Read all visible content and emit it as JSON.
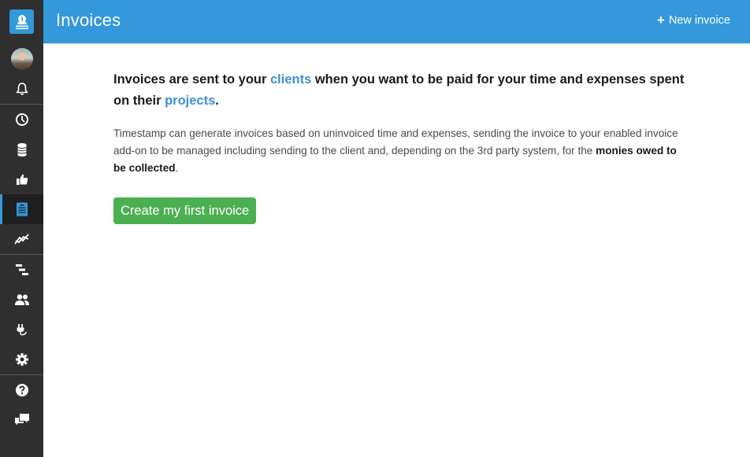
{
  "app": {
    "brand_color": "#3498db",
    "sidebar_bg": "#2f2f2f",
    "accent_green": "#4caf50"
  },
  "sidebar": {
    "logo_icon": "timestamp-logo-icon",
    "avatar_icon": "user-avatar",
    "items": [
      {
        "name": "notifications",
        "icon": "bell-icon",
        "active": false
      },
      {
        "name": "timesheets",
        "icon": "clock-icon",
        "active": false
      },
      {
        "name": "expenses",
        "icon": "coin-stack-icon",
        "active": false
      },
      {
        "name": "approvals",
        "icon": "thumbs-up-icon",
        "active": false
      },
      {
        "name": "invoices",
        "icon": "invoice-icon",
        "active": true
      },
      {
        "name": "reports",
        "icon": "chart-line-icon",
        "active": false
      },
      {
        "name": "projects",
        "icon": "tasks-icon",
        "active": false
      },
      {
        "name": "clients",
        "icon": "users-icon",
        "active": false
      },
      {
        "name": "add-ons",
        "icon": "plug-icon",
        "active": false
      },
      {
        "name": "settings",
        "icon": "gear-icon",
        "active": false
      },
      {
        "name": "help",
        "icon": "question-icon",
        "active": false
      },
      {
        "name": "feedback",
        "icon": "chat-icon",
        "active": false
      }
    ]
  },
  "header": {
    "title": "Invoices",
    "new_button_icon": "+",
    "new_button_label": "New invoice"
  },
  "main": {
    "lead": {
      "part1": "Invoices are sent to your ",
      "link1": "clients",
      "part2": " when you want to be paid for your time and expenses spent on their ",
      "link2": "projects",
      "part3": "."
    },
    "description": {
      "text": "Timestamp can generate invoices based on uninvoiced time and expenses, sending the invoice to your enabled invoice add-on to be managed including sending to the client and, depending on the 3rd party system, for the ",
      "bold": "monies owed to be collected",
      "end": "."
    },
    "cta_label": "Create my first invoice"
  }
}
